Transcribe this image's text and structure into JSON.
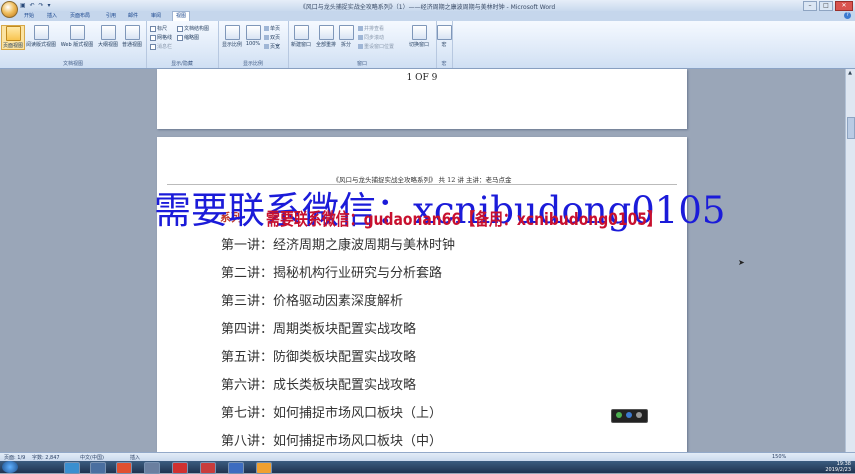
{
  "window": {
    "title": "《风口与龙头捕捉实战全攻略系列》（1）——经济周期之康波周期与美林时钟 - Microsoft Word",
    "qat": "▣ ↶ ↷ ▾",
    "controls": [
      "–",
      "□",
      "✕"
    ]
  },
  "tabs": [
    {
      "label": "开始",
      "active": false
    },
    {
      "label": "插入",
      "active": false
    },
    {
      "label": "页面布局",
      "active": false
    },
    {
      "label": "引用",
      "active": false
    },
    {
      "label": "邮件",
      "active": false
    },
    {
      "label": "审阅",
      "active": false
    },
    {
      "label": "视图",
      "active": true
    }
  ],
  "ribbon": {
    "views_group": {
      "label": "文档视图",
      "buttons": [
        "页面视图",
        "阅读版式视图",
        "Web 版式视图",
        "大纲视图",
        "普通视图"
      ]
    },
    "show_group": {
      "label": "显示/隐藏",
      "checks": [
        {
          "label": "标尺",
          "checked": false,
          "dim": false
        },
        {
          "label": "网格线",
          "checked": false,
          "dim": false
        },
        {
          "label": "消息栏",
          "checked": false,
          "dim": true
        },
        {
          "label": "文档结构图",
          "checked": false,
          "dim": false
        },
        {
          "label": "缩略图",
          "checked": false,
          "dim": false
        }
      ]
    },
    "zoom_group": {
      "label": "显示比例",
      "zoom_btn": "显示比例",
      "hundred_btn": "100%",
      "small": [
        "单页",
        "双页",
        "页宽"
      ]
    },
    "window_group": {
      "label": "窗口",
      "buttons": [
        "新建窗口",
        "全部重排",
        "拆分"
      ],
      "small": [
        "并排查看",
        "同步滚动",
        "重设窗口位置"
      ],
      "switch_btn": "切换窗口"
    },
    "macro_group": {
      "label": "宏",
      "button": "宏"
    }
  },
  "document": {
    "page_number": "1 OF 9",
    "header": "《风口与龙头捕捉实战全攻略系列》  共 12 讲    主讲：老马点金",
    "section_title": "系列",
    "lectures": [
      "第一讲：经济周期之康波周期与美林时钟",
      "第二讲：揭秘机构行业研究与分析套路",
      "第三讲：价格驱动因素深度解析",
      "第四讲：周期类板块配置实战攻略",
      "第五讲：防御类板块配置实战攻略",
      "第六讲：成长类板块配置实战攻略",
      "第七讲：如何捕捉市场风口板块（上）",
      "第八讲：如何捕捉市场风口板块（中）"
    ]
  },
  "watermarks": {
    "blue": "需要联系微信：xcnibudong0105",
    "red": "需要联系微信：gudaonan66【备用：xcnibudong0105】"
  },
  "statusbar": {
    "page": "页面: 1/9",
    "words": "字数: 2,847",
    "lang": "中文(中国)",
    "mode": "插入",
    "zoom": "150%"
  },
  "taskbar": {
    "time": "19:38",
    "date": "2019/2/23"
  },
  "colors": {
    "watermark_blue": "#1b1bd9",
    "watermark_red": "#c8102e",
    "section_red": "#c0392b",
    "ribbon_bg": "#dce8f7"
  }
}
